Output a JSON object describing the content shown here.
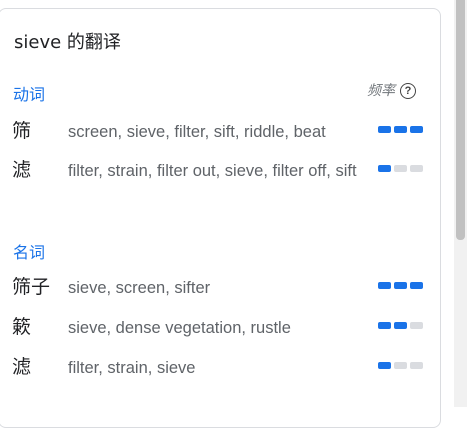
{
  "card": {
    "title": "sieve 的翻译",
    "frequency_label": "频率",
    "help_icon": "question-circle-icon",
    "accent_color": "#1a73e8"
  },
  "sections": [
    {
      "pos": "动词",
      "entries": [
        {
          "word": "筛",
          "synonyms": "screen, sieve, filter, sift, riddle, beat",
          "frequency": 3
        },
        {
          "word": "滤",
          "synonyms": "filter, strain, filter out, sieve, filter off, sift",
          "frequency": 1
        }
      ]
    },
    {
      "pos": "名词",
      "entries": [
        {
          "word": "筛子",
          "synonyms": "sieve, screen, sifter",
          "frequency": 3
        },
        {
          "word": "簌",
          "synonyms": "sieve, dense vegetation, rustle",
          "frequency": 2
        },
        {
          "word": "滤",
          "synonyms": "filter, strain, sieve",
          "frequency": 1
        }
      ]
    }
  ]
}
